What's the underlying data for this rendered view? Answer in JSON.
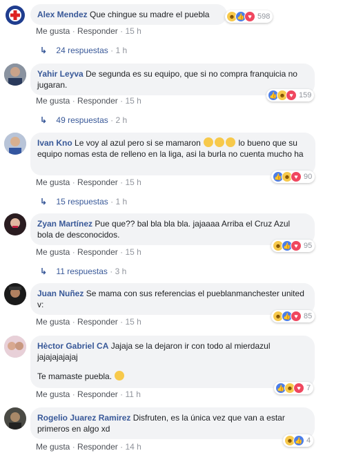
{
  "comments": [
    {
      "author": "Alex Mendez",
      "text": "Que chingue su madre el puebla",
      "reaction_count": "598",
      "like": "Me gusta",
      "reply": "Responder",
      "time": "15 h",
      "replies": "24 respuestas",
      "replies_time": "1 h"
    },
    {
      "author": "Yahir Leyva",
      "text": "De segunda es su equipo, que si no compra franquicia no jugaran.",
      "reaction_count": "159",
      "like": "Me gusta",
      "reply": "Responder",
      "time": "15 h",
      "replies": "49 respuestas",
      "replies_time": "2 h"
    },
    {
      "author": "Ivan Kno",
      "text_a": "Le voy al azul pero si se mamaron",
      "text_b": "lo bueno que su equipo nomas esta de relleno en la liga, asi la burla no cuenta mucho ha",
      "reaction_count": "90",
      "like": "Me gusta",
      "reply": "Responder",
      "time": "15 h",
      "replies": "15 respuestas",
      "replies_time": "1 h"
    },
    {
      "author": "Zyan Martínez",
      "text": "Pue que?? bal bla bla bla. jajaaaa Arriba el Cruz Azul bola de desconocidos.",
      "reaction_count": "95",
      "like": "Me gusta",
      "reply": "Responder",
      "time": "15 h",
      "replies": "11 respuestas",
      "replies_time": "3 h"
    },
    {
      "author": "Juan Nuñez",
      "text": "Se mama con sus referencias el pueblanmanchester united v:",
      "reaction_count": "85",
      "like": "Me gusta",
      "reply": "Responder",
      "time": "15 h"
    },
    {
      "author": "Hèctor Gabriel CA",
      "text": "Jajaja se la dejaron ir con todo al mierdazul jajajajajajaj",
      "text2": "Te mamaste puebla.",
      "reaction_count": "7",
      "like": "Me gusta",
      "reply": "Responder",
      "time": "11 h"
    },
    {
      "author": "Rogelio Juarez Ramirez",
      "text": "Disfruten, es la única vez que van a estar primeros en algo xd",
      "reaction_count": "4",
      "like": "Me gusta",
      "reply": "Responder",
      "time": "14 h"
    }
  ],
  "separator": "·",
  "icons": [
    "cruz-azul-logo",
    "like-reaction-icon",
    "haha-reaction-icon",
    "love-reaction-icon",
    "reply-arrow-icon",
    "laughing-emoji"
  ],
  "colors": {
    "author": "#385898",
    "bubble": "#f2f3f5",
    "meta": "#90949c"
  }
}
